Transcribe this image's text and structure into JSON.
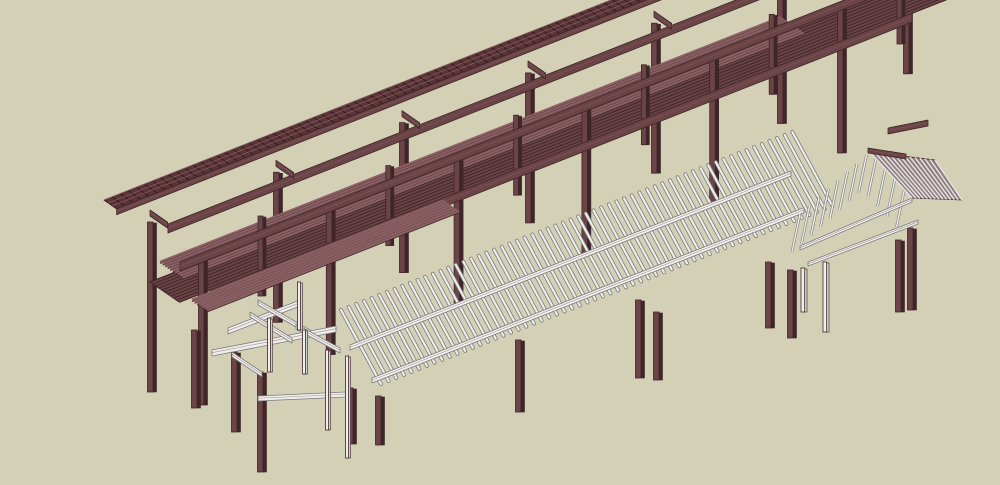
{
  "scene": {
    "background": "#d3d0b6",
    "model": "timber-frame-structure",
    "colors": {
      "timber": "#6b4447",
      "timber_dark": "#3e2628",
      "timber_light": "#8a6064",
      "roof_tile": "#5a3437",
      "new_member": "#eeeeec",
      "new_member_edge": "#7a7a7a"
    }
  }
}
